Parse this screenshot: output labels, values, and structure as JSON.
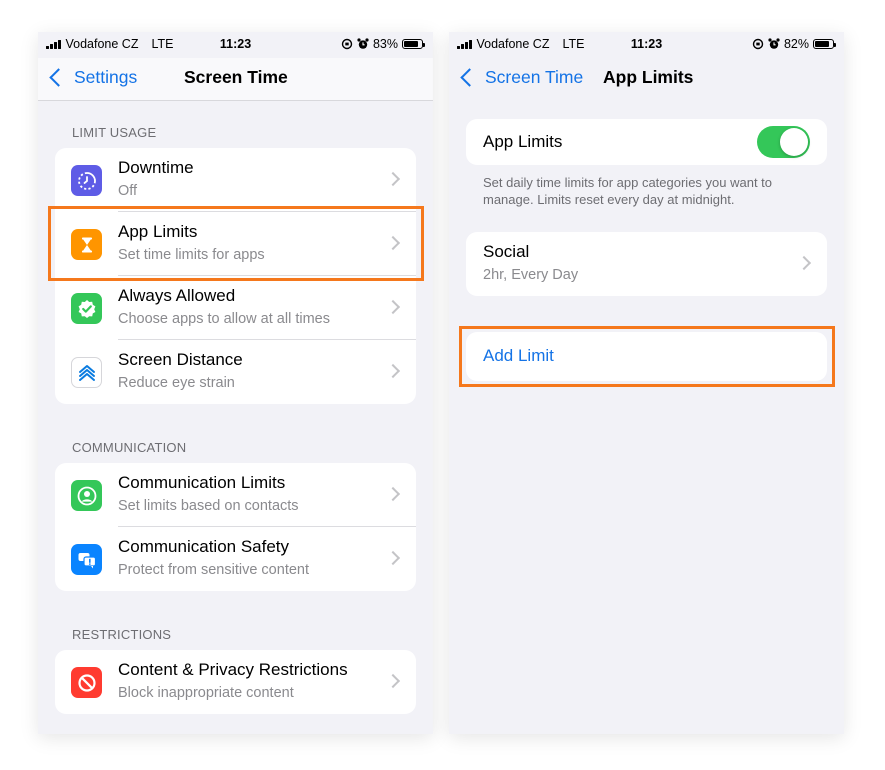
{
  "left": {
    "status": {
      "carrier": "Vodafone CZ",
      "network": "LTE",
      "time": "11:23",
      "battery": "83%",
      "battery_level": 0.83
    },
    "nav": {
      "back_label": "Settings",
      "title": "Screen Time"
    },
    "sections": [
      {
        "header": "LIMIT USAGE",
        "items": [
          {
            "title": "Downtime",
            "subtitle": "Off",
            "icon": "downtime-icon",
            "icon_color": "#5e5ce6"
          },
          {
            "title": "App Limits",
            "subtitle": "Set time limits for apps",
            "icon": "hourglass-icon",
            "icon_color": "#ff9500"
          },
          {
            "title": "Always Allowed",
            "subtitle": "Choose apps to allow at all times",
            "icon": "checkmark-badge-icon",
            "icon_color": "#34c759"
          },
          {
            "title": "Screen Distance",
            "subtitle": "Reduce eye strain",
            "icon": "screen-distance-icon",
            "icon_color": "#ffffff"
          }
        ]
      },
      {
        "header": "COMMUNICATION",
        "items": [
          {
            "title": "Communication Limits",
            "subtitle": "Set limits based on contacts",
            "icon": "person-circle-icon",
            "icon_color": "#34c759"
          },
          {
            "title": "Communication Safety",
            "subtitle": "Protect from sensitive content",
            "icon": "chat-bubbles-icon",
            "icon_color": "#0a84ff"
          }
        ]
      },
      {
        "header": "RESTRICTIONS",
        "items": [
          {
            "title": "Content & Privacy Restrictions",
            "subtitle": "Block inappropriate content",
            "icon": "no-entry-icon",
            "icon_color": "#ff3b30"
          }
        ]
      }
    ]
  },
  "right": {
    "status": {
      "carrier": "Vodafone CZ",
      "network": "LTE",
      "time": "11:23",
      "battery": "82%",
      "battery_level": 0.82
    },
    "nav": {
      "back_label": "Screen Time",
      "title": "App Limits"
    },
    "toggle": {
      "label": "App Limits",
      "enabled": true
    },
    "description": "Set daily time limits for app categories you want to manage. Limits reset every day at midnight.",
    "limit": {
      "title": "Social",
      "subtitle": "2hr, Every Day"
    },
    "add_limit_label": "Add Limit"
  },
  "colors": {
    "accent": "#1473e6",
    "highlight": "#f5781c",
    "toggle_on": "#34c759"
  }
}
